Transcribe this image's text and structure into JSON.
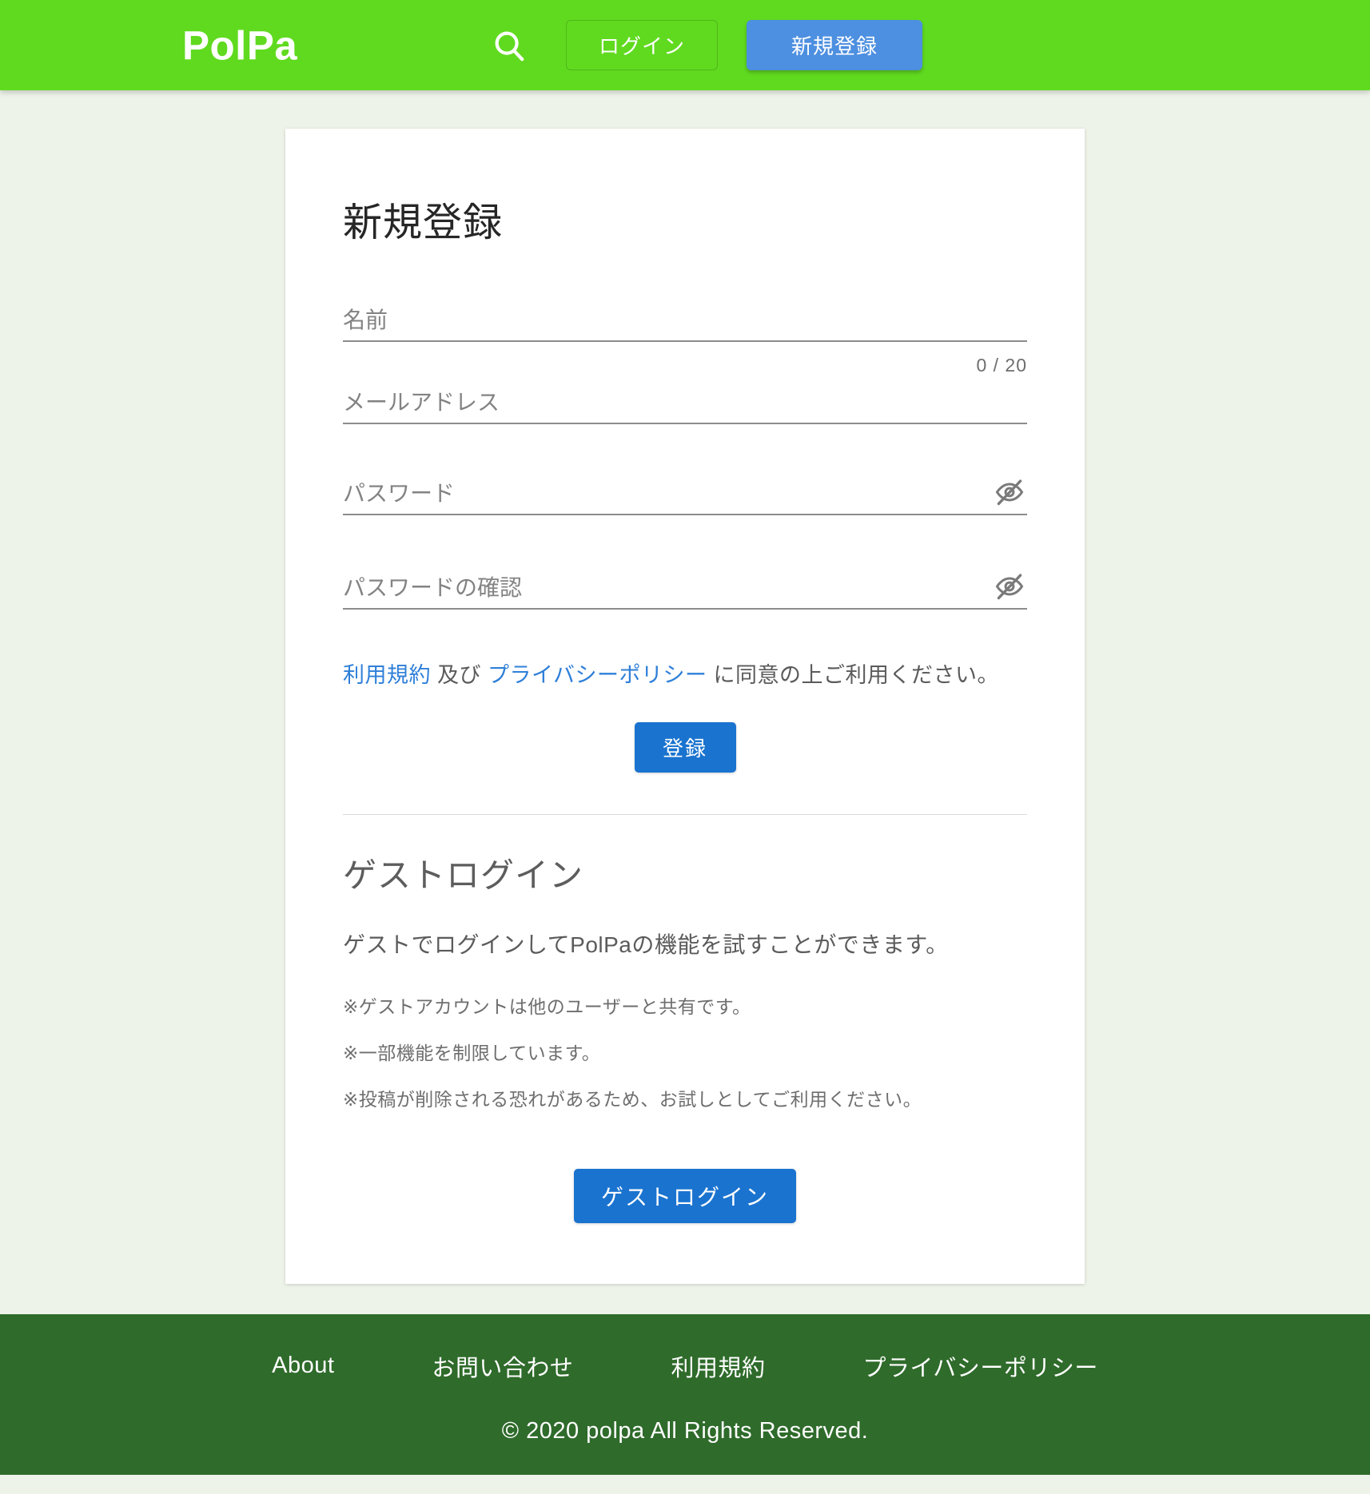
{
  "header": {
    "brand": "PolPa",
    "search_icon": "search-icon",
    "login_label": "ログイン",
    "signup_label": "新規登録",
    "bg_color": "#60da1f",
    "signup_bg_color": "#4d8fe0"
  },
  "signup_card": {
    "title": "新規登録",
    "fields": [
      {
        "name": "name",
        "placeholder": "名前",
        "value": "",
        "counter": "0 / 20",
        "has_eye": false
      },
      {
        "name": "email",
        "placeholder": "メールアドレス",
        "value": "",
        "counter": "",
        "has_eye": false
      },
      {
        "name": "password",
        "placeholder": "パスワード",
        "value": "",
        "counter": "",
        "has_eye": true,
        "eye_icon": "eye-off-icon"
      },
      {
        "name": "password_confirm",
        "placeholder": "パスワードの確認",
        "value": "",
        "counter": "",
        "has_eye": true,
        "eye_icon": "eye-off-icon"
      }
    ],
    "terms": {
      "terms_link": "利用規約",
      "middle": " 及び ",
      "privacy_link": "プライバシーポリシー",
      "suffix": " に同意の上ご利用ください。",
      "link_color": "#2f7fd8"
    },
    "submit_label": "登録",
    "submit_color": "#1a73cf"
  },
  "guest": {
    "title": "ゲストログイン",
    "description": "ゲストでログインしてPolPaの機能を試すことができます。",
    "notes": [
      "※ゲストアカウントは他のユーザーと共有です。",
      "※一部機能を制限しています。",
      "※投稿が削除される恐れがあるため、お試しとしてご利用ください。"
    ],
    "button_label": "ゲストログイン"
  },
  "footer": {
    "links": [
      "About",
      "お問い合わせ",
      "利用規約",
      "プライバシーポリシー"
    ],
    "copyright": "© 2020 polpa All Rights Reserved.",
    "bg_color": "#2f6b2b"
  }
}
